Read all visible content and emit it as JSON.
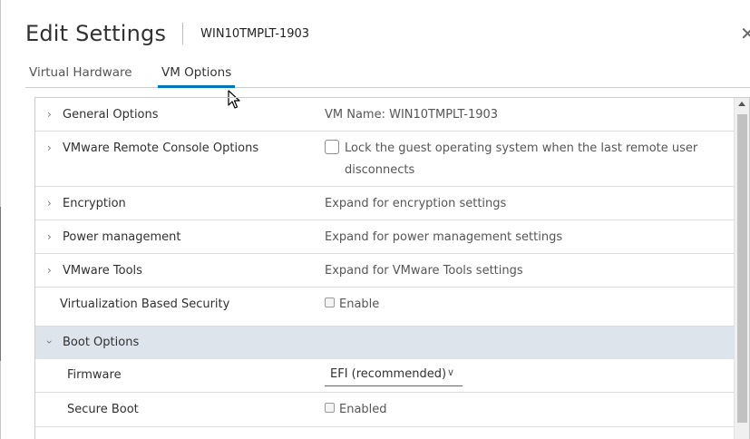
{
  "dialog": {
    "title": "Edit Settings",
    "subtitle": "WIN10TMPLT-1903",
    "close_icon": "close-icon"
  },
  "tabs": [
    {
      "label": "Virtual Hardware",
      "active": false
    },
    {
      "label": "VM Options",
      "active": true
    }
  ],
  "accent_color": "#0079b8",
  "rows": {
    "general": {
      "label": "General Options",
      "value": "VM Name: WIN10TMPLT-1903"
    },
    "vmrc": {
      "label": "VMware Remote Console Options",
      "checkbox_label": "Lock the guest operating system when the last remote user disconnects",
      "checked": false
    },
    "encryption": {
      "label": "Encryption",
      "value": "Expand for encryption settings"
    },
    "power": {
      "label": "Power management",
      "value": "Expand for power management settings"
    },
    "tools": {
      "label": "VMware Tools",
      "value": "Expand for VMware Tools settings"
    },
    "vbs": {
      "label": "Virtualization Based Security",
      "checkbox_label": "Enable",
      "checked": false
    },
    "boot": {
      "label": "Boot Options",
      "expanded": true
    },
    "firmware": {
      "label": "Firmware",
      "selected": "EFI (recommended)"
    },
    "secure_boot": {
      "label": "Secure Boot",
      "checkbox_label": "Enabled",
      "checked": false
    }
  }
}
